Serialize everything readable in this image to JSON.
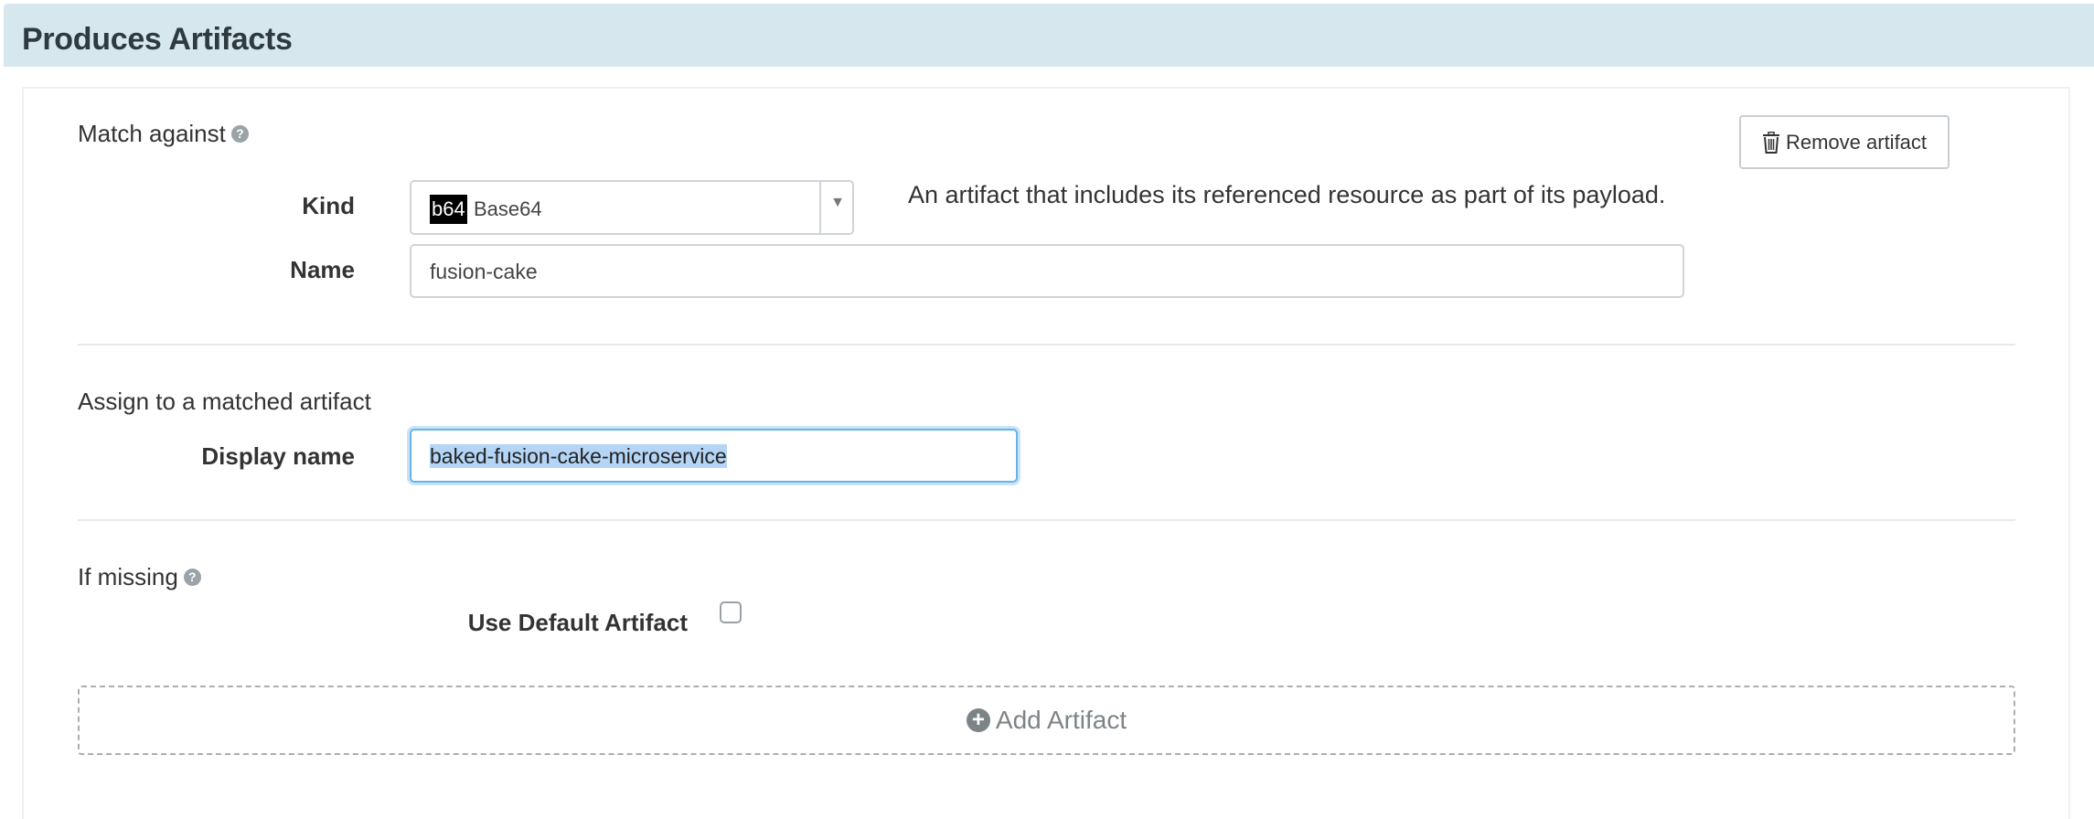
{
  "header": {
    "title": "Produces Artifacts"
  },
  "match_section": {
    "heading": "Match against",
    "help_icon": "question-circle-icon",
    "kind_label": "Kind",
    "kind_badge": "b64",
    "kind_value": "Base64",
    "kind_description": "An artifact that includes its referenced resource as part of its payload.",
    "name_label": "Name",
    "name_value": "fusion-cake"
  },
  "remove_button": {
    "label": "Remove artifact",
    "icon": "trash-icon"
  },
  "assign_section": {
    "heading": "Assign to a matched artifact",
    "display_name_label": "Display name",
    "display_name_value": "baked-fusion-cake-microservice"
  },
  "missing_section": {
    "heading": "If missing",
    "help_icon": "question-circle-icon",
    "use_default_label": "Use Default Artifact",
    "use_default_checked": false
  },
  "add_artifact": {
    "label": "Add Artifact",
    "icon": "plus-circle-icon"
  },
  "colors": {
    "header_bg": "#d6e8ee",
    "focus_border": "#66b3ea",
    "selection": "#b4d5f5"
  }
}
